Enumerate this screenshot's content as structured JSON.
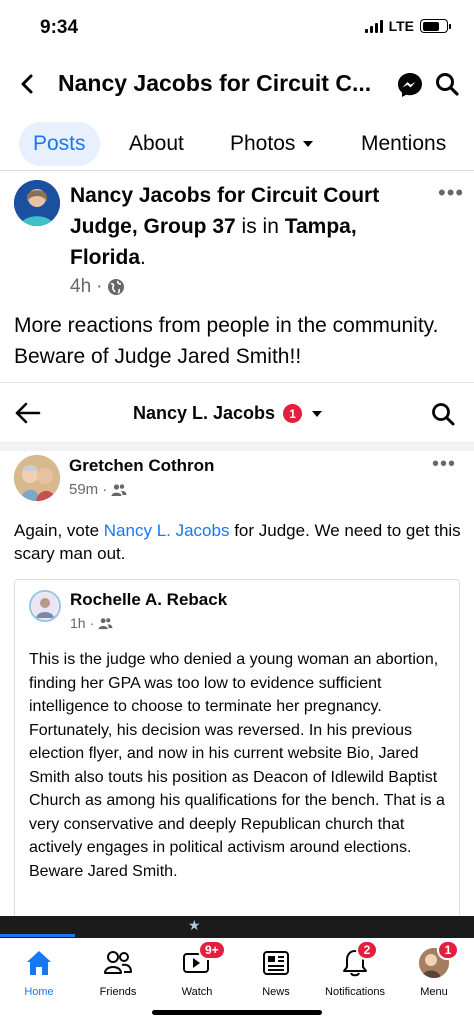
{
  "status_bar": {
    "time": "9:34",
    "network": "LTE"
  },
  "header": {
    "title": "Nancy Jacobs for Circuit C...",
    "icons": [
      "back-icon",
      "messenger-icon",
      "search-icon"
    ]
  },
  "tabs": [
    {
      "label": "Posts",
      "active": true
    },
    {
      "label": "About"
    },
    {
      "label": "Photos"
    },
    {
      "label": "Mentions"
    }
  ],
  "post": {
    "author": "Nancy Jacobs for Circuit Court Judge, Group 37",
    "is_in": " is in ",
    "location": "Tampa, Florida",
    "period": ".",
    "time": "4h",
    "separator": "·",
    "privacy_icon": "globe-icon",
    "caption": "More reactions from people in the community. Beware of Judge Jared Smith!!"
  },
  "embedded": {
    "title": "Nancy L. Jacobs",
    "badge": "1",
    "comment": {
      "author": "Gretchen Cothron",
      "time": "59m",
      "separator": "·",
      "text_before": "Again, vote ",
      "link_text": "Nancy L. Jacobs",
      "text_after": " for Judge. We need to get this scary man out."
    },
    "shared": {
      "author": "Rochelle A. Reback",
      "time": "1h",
      "separator": "·",
      "text": "This is the judge who denied a young woman an abortion, finding her GPA was too low to evidence sufficient intelligence to choose to terminate her pregnancy. Fortunately, his decision was reversed. In his previous election flyer, and now in his current website Bio, Jared Smith also touts his position as Deacon of Idlewild Baptist Church as among his qualifications for the bench. That is a very conservative and deeply Republican church that actively engages in political activism around elections. Beware Jared Smith."
    }
  },
  "bottom_nav": [
    {
      "label": "Home",
      "active": true,
      "icon": "home-icon"
    },
    {
      "label": "Friends",
      "icon": "friends-icon"
    },
    {
      "label": "Watch",
      "icon": "watch-icon",
      "badge": "9+"
    },
    {
      "label": "News",
      "icon": "news-icon"
    },
    {
      "label": "Notifications",
      "icon": "bell-icon",
      "badge": "2"
    },
    {
      "label": "Menu",
      "icon": "menu-avatar",
      "badge": "1"
    }
  ],
  "colors": {
    "accent": "#1877f2",
    "badge": "#e41e3f",
    "secondary_text": "#65676b"
  }
}
